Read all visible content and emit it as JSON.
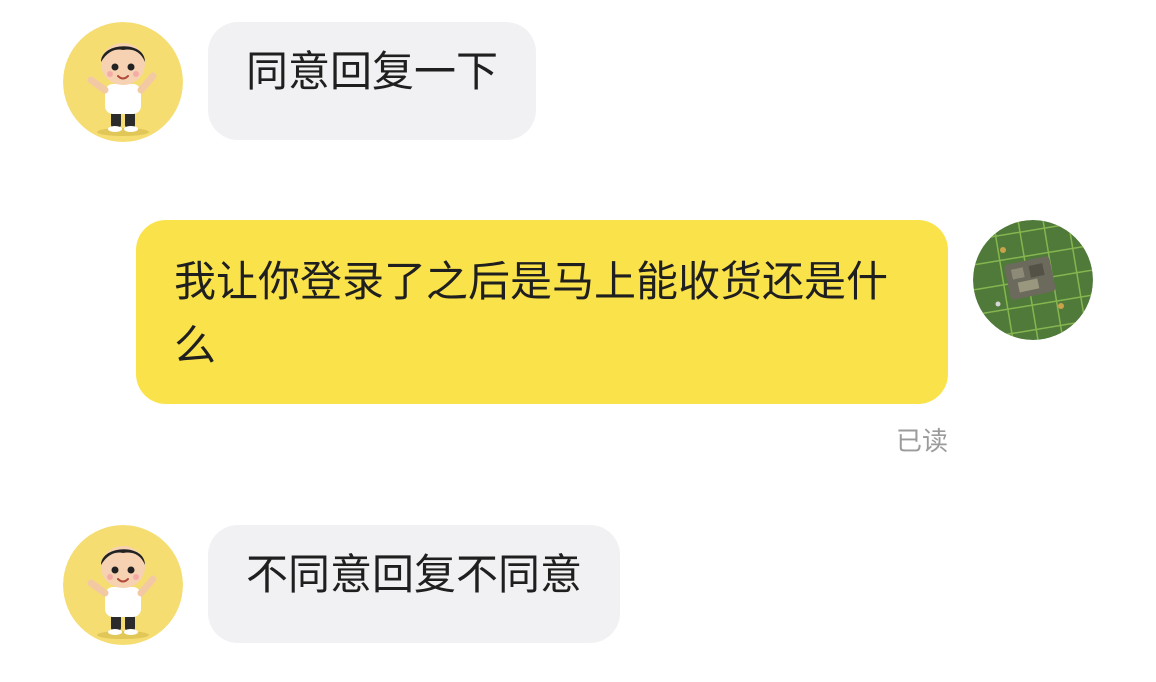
{
  "messages": [
    {
      "direction": "incoming",
      "text": "同意回复一下"
    },
    {
      "direction": "outgoing",
      "text": "我让你登录了之后是马上能收货还是什么",
      "status": "已读"
    },
    {
      "direction": "incoming",
      "text": "不同意回复不同意"
    }
  ],
  "avatars": {
    "other": {
      "icon": "cartoon-boy-avatar-icon",
      "background": "#f5dd72"
    },
    "self": {
      "icon": "game-map-avatar-icon",
      "background": "#4f7a3a"
    }
  },
  "colors": {
    "incoming_bubble": "#f1f1f3",
    "outgoing_bubble": "#fae34a",
    "read_status": "#9b9b9b"
  }
}
